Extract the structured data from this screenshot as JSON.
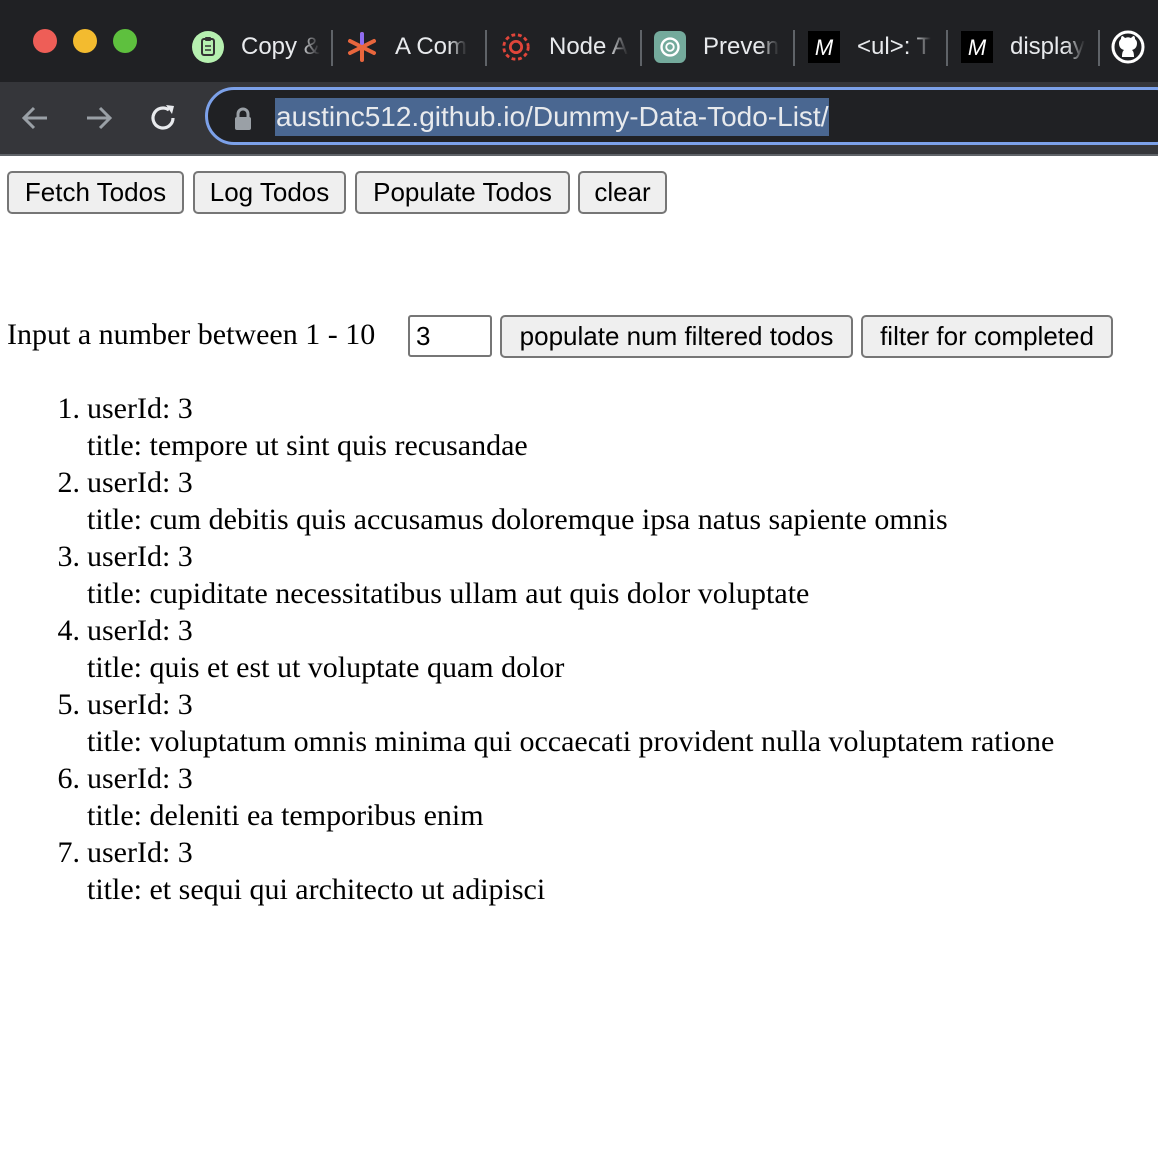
{
  "browser": {
    "tabs": [
      {
        "label": "Copy &",
        "icon": "clipboard-icon"
      },
      {
        "label": "A Com",
        "icon": "asterisk-icon"
      },
      {
        "label": "Node A",
        "icon": "node-icon"
      },
      {
        "label": "Preven",
        "icon": "openai-icon"
      },
      {
        "label": "<ul>: T",
        "icon": "mdn-icon"
      },
      {
        "label": "display",
        "icon": "mdn-icon"
      }
    ],
    "url": "austinc512.github.io/Dummy-Data-Todo-List/",
    "colors": {
      "frame": "#202124",
      "toolbar": "#35363a",
      "omnibox_focus": "#7ca1e9"
    }
  },
  "toolbar": {
    "fetch_label": "Fetch Todos",
    "log_label": "Log Todos",
    "populate_label": "Populate Todos",
    "clear_label": "clear"
  },
  "filter": {
    "prompt": "Input a number between 1 - 10",
    "value": "3",
    "populate_filtered_label": "populate num filtered todos",
    "completed_label": "filter for completed"
  },
  "todos": [
    {
      "num": "1.",
      "user": "userId: 3",
      "title": "title: tempore ut sint quis recusandae"
    },
    {
      "num": "2.",
      "user": "userId: 3",
      "title": "title: cum debitis quis accusamus doloremque ipsa natus sapiente omnis"
    },
    {
      "num": "3.",
      "user": "userId: 3",
      "title": "title: cupiditate necessitatibus ullam aut quis dolor voluptate"
    },
    {
      "num": "4.",
      "user": "userId: 3",
      "title": "title: quis et est ut voluptate quam dolor"
    },
    {
      "num": "5.",
      "user": "userId: 3",
      "title": "title: voluptatum omnis minima qui occaecati provident nulla voluptatem ratione"
    },
    {
      "num": "6.",
      "user": "userId: 3",
      "title": "title: deleniti ea temporibus enim"
    },
    {
      "num": "7.",
      "user": "userId: 3",
      "title": "title: et sequi qui architecto ut adipisci"
    }
  ]
}
